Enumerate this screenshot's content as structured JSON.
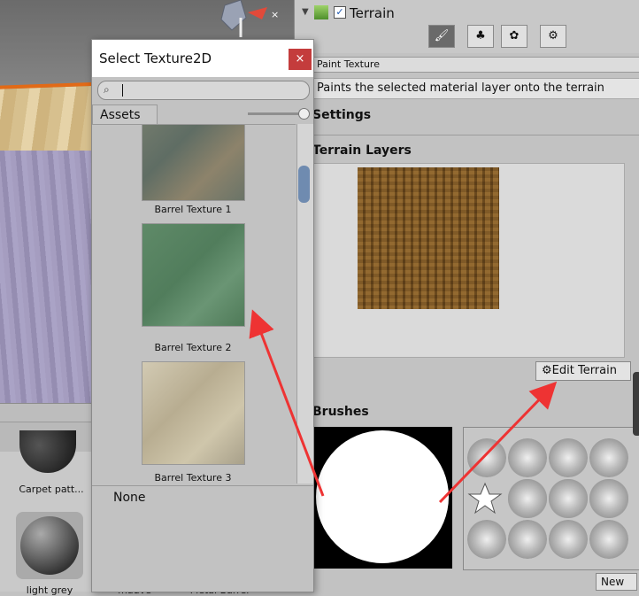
{
  "dialog": {
    "title": "Select Texture2D",
    "close": "×",
    "search_value": "",
    "tab_assets": "Assets",
    "items": [
      {
        "label": "Barrel Texture 1",
        "color": "#6f7a6e"
      },
      {
        "label": "Barrel Texture 2",
        "color": "#5f8a68"
      },
      {
        "label": "Barrel Texture 3",
        "color": "#c9c0a6"
      }
    ],
    "none_label": "None"
  },
  "inspector": {
    "component_name": "Terrain",
    "tool_icons": [
      "paintbrush-icon",
      "tree-icon",
      "detail-icon",
      "gear-icon"
    ],
    "paint_dropdown": "Paint Texture",
    "paint_description": "Paints the selected material layer onto the terrain",
    "settings_title": "Settings",
    "terrain_layers_title": "Terrain Layers",
    "edit_terrain_label": "Edit Terrain",
    "brushes_title": "Brushes",
    "new_label": "New"
  },
  "project": {
    "items": [
      {
        "label": "Carpet patt..."
      },
      {
        "label": "light grey"
      },
      {
        "label": "mauve"
      },
      {
        "label": "Metal Barrel"
      }
    ]
  },
  "colors": {
    "arrow": "#ee3333",
    "close_red": "#c43c3c",
    "scroll_blue": "#6f8bb0"
  }
}
